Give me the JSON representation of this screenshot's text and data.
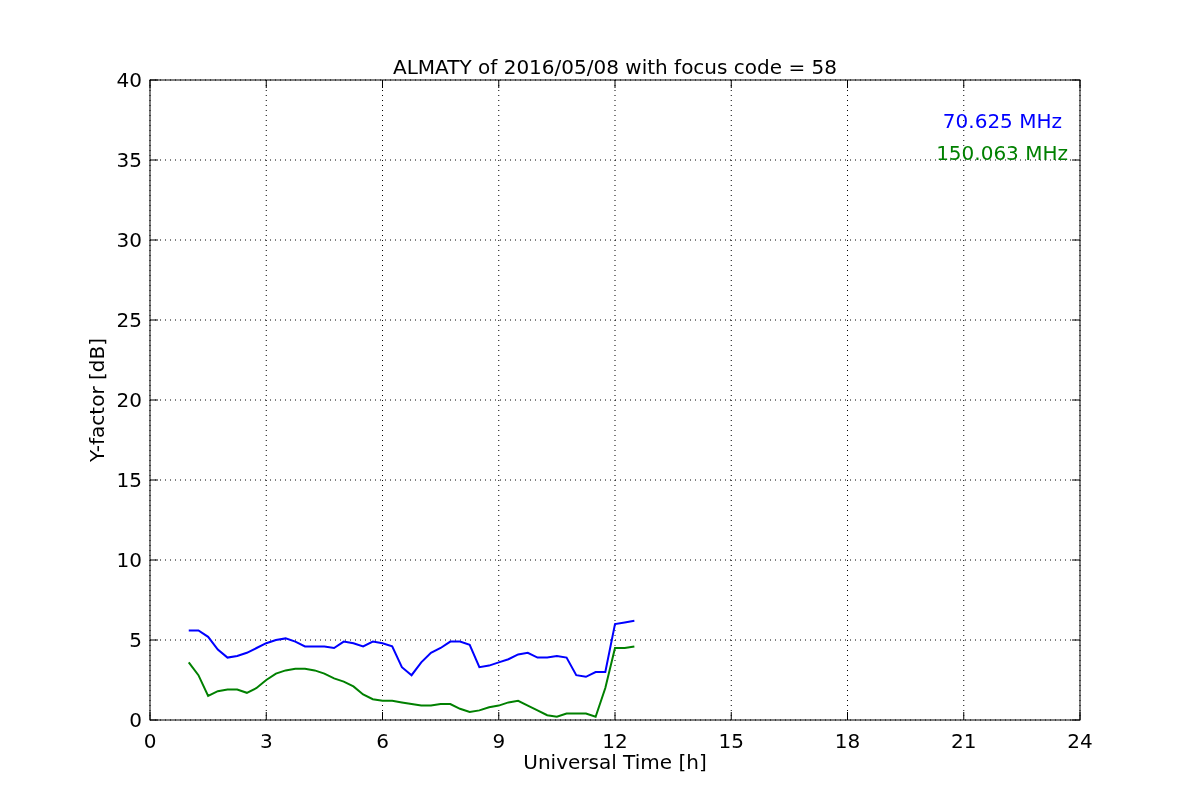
{
  "figure": {
    "chart_data": {
      "type": "line",
      "title": "ALMATY of 2016/05/08 with focus code = 58",
      "xlabel": "Universal Time [h]",
      "ylabel": "Y-factor [dB]",
      "x": [
        1.0,
        1.25,
        1.5,
        1.75,
        2.0,
        2.25,
        2.5,
        2.75,
        3.0,
        3.25,
        3.5,
        3.75,
        4.0,
        4.25,
        4.5,
        4.75,
        5.0,
        5.25,
        5.5,
        5.75,
        6.0,
        6.25,
        6.5,
        6.75,
        7.0,
        7.25,
        7.5,
        7.75,
        8.0,
        8.25,
        8.5,
        8.75,
        9.0,
        9.25,
        9.5,
        9.75,
        10.0,
        10.25,
        10.5,
        10.75,
        11.0,
        11.25,
        11.5,
        11.75,
        12.0,
        12.25,
        12.5
      ],
      "series": [
        {
          "name": "70.625 MHz",
          "color": "#0000ff",
          "values": [
            5.6,
            5.6,
            5.2,
            4.4,
            3.9,
            4.0,
            4.2,
            4.5,
            4.8,
            5.0,
            5.1,
            4.9,
            4.6,
            4.6,
            4.6,
            4.5,
            4.9,
            4.8,
            4.6,
            4.9,
            4.8,
            4.6,
            3.3,
            2.8,
            3.6,
            4.2,
            4.5,
            4.9,
            4.9,
            4.7,
            3.3,
            3.4,
            3.6,
            3.8,
            4.1,
            4.2,
            3.9,
            3.9,
            4.0,
            3.9,
            2.8,
            2.7,
            3.0,
            3.0,
            6.0,
            6.1,
            6.2
          ]
        },
        {
          "name": "150.063 MHz",
          "color": "#008000",
          "values": [
            3.6,
            2.8,
            1.5,
            1.8,
            1.9,
            1.9,
            1.7,
            2.0,
            2.5,
            2.9,
            3.1,
            3.2,
            3.2,
            3.1,
            2.9,
            2.6,
            2.4,
            2.1,
            1.6,
            1.3,
            1.2,
            1.2,
            1.1,
            1.0,
            0.9,
            0.9,
            1.0,
            1.0,
            0.7,
            0.5,
            0.6,
            0.8,
            0.9,
            1.1,
            1.2,
            0.9,
            0.6,
            0.3,
            0.2,
            0.4,
            0.4,
            0.4,
            0.2,
            2.0,
            4.5,
            4.5,
            4.6
          ]
        }
      ],
      "grid": true,
      "xlim": [
        0,
        24
      ],
      "ylim": [
        0,
        40
      ],
      "xticks": [
        0,
        3,
        6,
        9,
        12,
        15,
        18,
        21,
        24
      ],
      "yticks": [
        0,
        5,
        10,
        15,
        20,
        25,
        30,
        35,
        40
      ]
    }
  }
}
